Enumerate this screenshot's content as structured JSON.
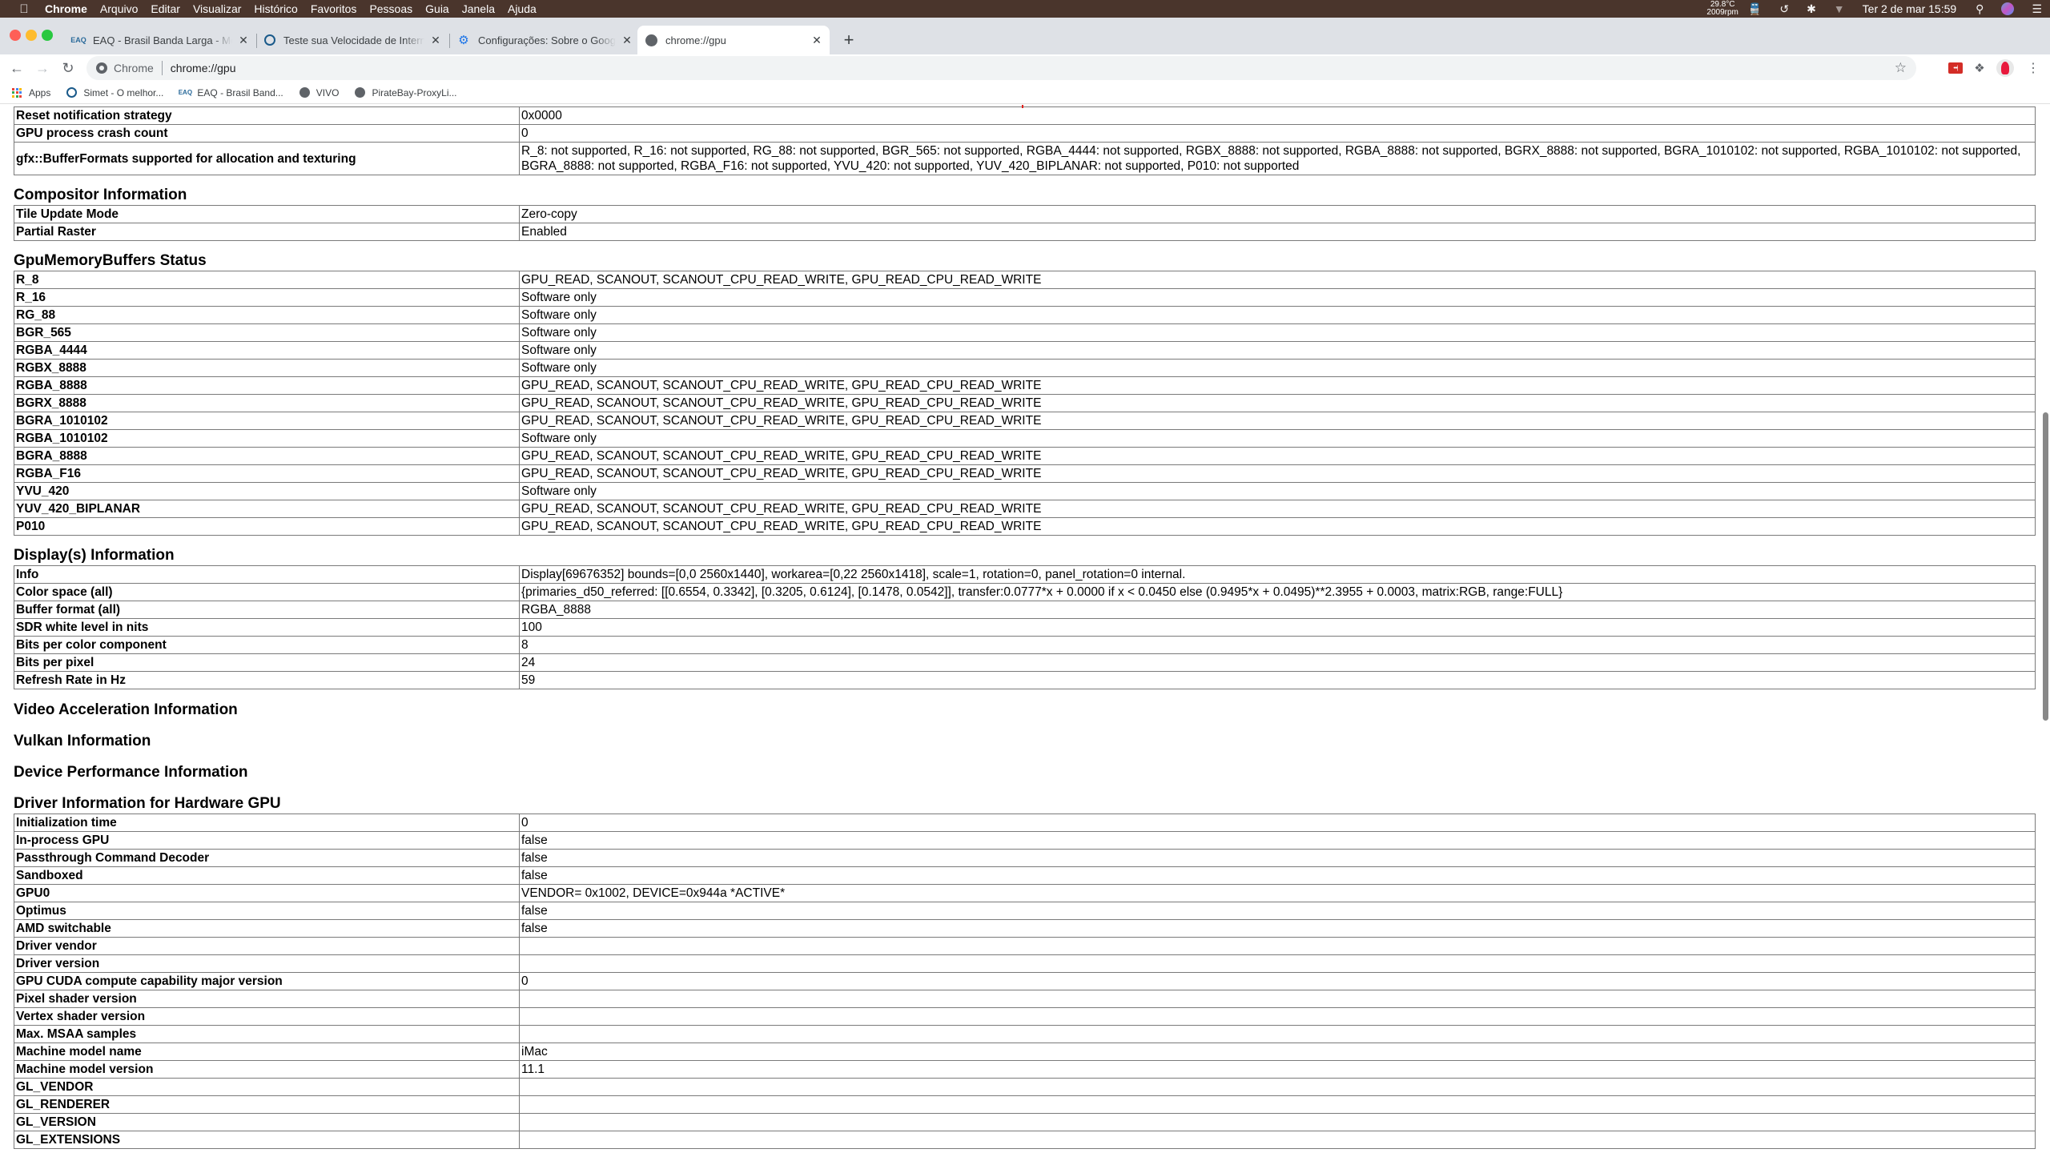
{
  "menubar": {
    "apple_icon": "apple-logo",
    "app_name": "Chrome",
    "items": [
      "Arquivo",
      "Editar",
      "Visualizar",
      "Histórico",
      "Favoritos",
      "Pessoas",
      "Guia",
      "Janela",
      "Ajuda"
    ],
    "temperature": "29.8°C",
    "fan_speed": "2009rpm",
    "status_icons": [
      "train-icon",
      "time-machine-icon",
      "bluetooth-icon",
      "wifi-off-icon"
    ],
    "clock": "Ter 2 de mar  15:59",
    "right_icons": [
      "spotlight-search-icon",
      "siri-icon",
      "notification-center-icon"
    ]
  },
  "tabs": [
    {
      "title": "EAQ - Brasil Banda Larga - Medidor",
      "favicon": "eaq-icon",
      "active": false
    },
    {
      "title": "Teste sua Velocidade de Internet",
      "favicon": "speedometer-icon",
      "active": false
    },
    {
      "title": "Configurações: Sobre o Google Chrome",
      "favicon": "gear-icon",
      "active": false
    },
    {
      "title": "chrome://gpu",
      "favicon": "globe-icon",
      "active": true
    }
  ],
  "toolbar": {
    "site_chip": "Chrome",
    "url": "chrome://gpu"
  },
  "bookmarks": [
    {
      "label": "Apps",
      "icon": "apps-grid-icon"
    },
    {
      "label": "Simet - O melhor...",
      "icon": "speedometer-icon"
    },
    {
      "label": "EAQ - Brasil Band...",
      "icon": "eaq-icon"
    },
    {
      "label": "VIVO",
      "icon": "globe-icon"
    },
    {
      "label": "PirateBay-ProxyLi...",
      "icon": "globe-icon"
    }
  ],
  "page": {
    "top_rows": [
      {
        "label": "Reset notification strategy",
        "value": "0x0000"
      },
      {
        "label": "GPU process crash count",
        "value": "0"
      },
      {
        "label": "gfx::BufferFormats supported for allocation and texturing",
        "value": "R_8: not supported, R_16: not supported, RG_88: not supported, BGR_565: not supported, RGBA_4444: not supported, RGBX_8888: not supported, RGBA_8888: not supported, BGRX_8888: not supported, BGRA_1010102: not supported, RGBA_1010102: not supported, BGRA_8888: not supported, RGBA_F16: not supported, YVU_420: not supported, YUV_420_BIPLANAR: not supported, P010: not supported"
      }
    ],
    "compositor": {
      "title": "Compositor Information",
      "rows": [
        {
          "label": "Tile Update Mode",
          "value": "Zero-copy"
        },
        {
          "label": "Partial Raster",
          "value": "Enabled"
        }
      ]
    },
    "gmb": {
      "title": "GpuMemoryBuffers Status",
      "rows": [
        {
          "label": "R_8",
          "value": "GPU_READ, SCANOUT, SCANOUT_CPU_READ_WRITE, GPU_READ_CPU_READ_WRITE"
        },
        {
          "label": "R_16",
          "value": "Software only"
        },
        {
          "label": "RG_88",
          "value": "Software only"
        },
        {
          "label": "BGR_565",
          "value": "Software only"
        },
        {
          "label": "RGBA_4444",
          "value": "Software only"
        },
        {
          "label": "RGBX_8888",
          "value": "Software only"
        },
        {
          "label": "RGBA_8888",
          "value": "GPU_READ, SCANOUT, SCANOUT_CPU_READ_WRITE, GPU_READ_CPU_READ_WRITE"
        },
        {
          "label": "BGRX_8888",
          "value": "GPU_READ, SCANOUT, SCANOUT_CPU_READ_WRITE, GPU_READ_CPU_READ_WRITE"
        },
        {
          "label": "BGRA_1010102",
          "value": "GPU_READ, SCANOUT, SCANOUT_CPU_READ_WRITE, GPU_READ_CPU_READ_WRITE"
        },
        {
          "label": "RGBA_1010102",
          "value": "Software only"
        },
        {
          "label": "BGRA_8888",
          "value": "GPU_READ, SCANOUT, SCANOUT_CPU_READ_WRITE, GPU_READ_CPU_READ_WRITE"
        },
        {
          "label": "RGBA_F16",
          "value": "GPU_READ, SCANOUT, SCANOUT_CPU_READ_WRITE, GPU_READ_CPU_READ_WRITE"
        },
        {
          "label": "YVU_420",
          "value": "Software only"
        },
        {
          "label": "YUV_420_BIPLANAR",
          "value": "GPU_READ, SCANOUT, SCANOUT_CPU_READ_WRITE, GPU_READ_CPU_READ_WRITE"
        },
        {
          "label": "P010",
          "value": "GPU_READ, SCANOUT, SCANOUT_CPU_READ_WRITE, GPU_READ_CPU_READ_WRITE"
        }
      ]
    },
    "displays": {
      "title": "Display(s) Information",
      "rows": [
        {
          "label": "Info",
          "value": "Display[69676352] bounds=[0,0 2560x1440], workarea=[0,22 2560x1418], scale=1, rotation=0, panel_rotation=0 internal."
        },
        {
          "label": "Color space (all)",
          "value": "{primaries_d50_referred: [[0.6554, 0.3342], [0.3205, 0.6124], [0.1478, 0.0542]], transfer:0.0777*x + 0.0000 if x < 0.0450 else (0.9495*x + 0.0495)**2.3955 + 0.0003, matrix:RGB, range:FULL}"
        },
        {
          "label": "Buffer format (all)",
          "value": "RGBA_8888"
        },
        {
          "label": "SDR white level in nits",
          "value": "100"
        },
        {
          "label": "Bits per color component",
          "value": "8"
        },
        {
          "label": "Bits per pixel",
          "value": "24"
        },
        {
          "label": "Refresh Rate in Hz",
          "value": "59"
        }
      ]
    },
    "video_accel_title": "Video Acceleration Information",
    "vulkan_title": "Vulkan Information",
    "device_perf_title": "Device Performance Information",
    "driver": {
      "title": "Driver Information for Hardware GPU",
      "rows": [
        {
          "label": "Initialization time",
          "value": "0"
        },
        {
          "label": "In-process GPU",
          "value": "false"
        },
        {
          "label": "Passthrough Command Decoder",
          "value": "false"
        },
        {
          "label": "Sandboxed",
          "value": "false"
        },
        {
          "label": "GPU0",
          "value": "VENDOR= 0x1002, DEVICE=0x944a *ACTIVE*"
        },
        {
          "label": "Optimus",
          "value": "false"
        },
        {
          "label": "AMD switchable",
          "value": "false"
        },
        {
          "label": "Driver vendor",
          "value": ""
        },
        {
          "label": "Driver version",
          "value": ""
        },
        {
          "label": "GPU CUDA compute capability major version",
          "value": "0"
        },
        {
          "label": "Pixel shader version",
          "value": ""
        },
        {
          "label": "Vertex shader version",
          "value": ""
        },
        {
          "label": "Max. MSAA samples",
          "value": ""
        },
        {
          "label": "Machine model name",
          "value": "iMac"
        },
        {
          "label": "Machine model version",
          "value": "11.1"
        },
        {
          "label": "GL_VENDOR",
          "value": ""
        },
        {
          "label": "GL_RENDERER",
          "value": ""
        },
        {
          "label": "GL_VERSION",
          "value": ""
        },
        {
          "label": "GL_EXTENSIONS",
          "value": ""
        }
      ]
    }
  }
}
